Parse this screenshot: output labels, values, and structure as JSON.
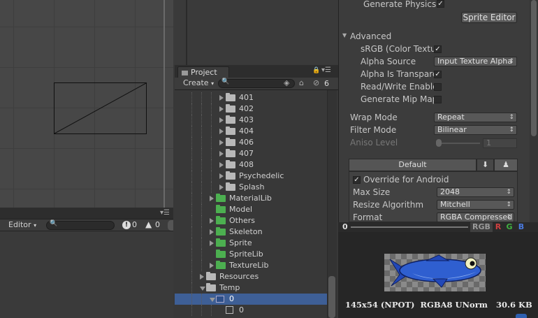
{
  "console": {
    "editor_label": "Editor",
    "error_count": "0",
    "warning_count": "0"
  },
  "project": {
    "tab_label": "Project",
    "create_label": "Create",
    "hidden_count": "6",
    "tree": [
      {
        "label": "401",
        "depth": 4,
        "type": "folder",
        "expanded": false
      },
      {
        "label": "402",
        "depth": 4,
        "type": "folder",
        "expanded": false
      },
      {
        "label": "403",
        "depth": 4,
        "type": "folder",
        "expanded": false
      },
      {
        "label": "404",
        "depth": 4,
        "type": "folder",
        "expanded": false
      },
      {
        "label": "406",
        "depth": 4,
        "type": "folder",
        "expanded": false
      },
      {
        "label": "407",
        "depth": 4,
        "type": "folder",
        "expanded": false
      },
      {
        "label": "408",
        "depth": 4,
        "type": "folder",
        "expanded": false
      },
      {
        "label": "Psychedelic",
        "depth": 4,
        "type": "folder",
        "expanded": false
      },
      {
        "label": "Splash",
        "depth": 4,
        "type": "folder",
        "expanded": false
      },
      {
        "label": "MaterialLib",
        "depth": 3,
        "type": "folder-green",
        "expanded": false
      },
      {
        "label": "Model",
        "depth": 3,
        "type": "folder-green",
        "expanded": null
      },
      {
        "label": "Others",
        "depth": 3,
        "type": "folder-green",
        "expanded": false
      },
      {
        "label": "Skeleton",
        "depth": 3,
        "type": "folder-green",
        "expanded": false
      },
      {
        "label": "Sprite",
        "depth": 3,
        "type": "folder-green",
        "expanded": false
      },
      {
        "label": "SpriteLib",
        "depth": 3,
        "type": "folder-green",
        "expanded": null
      },
      {
        "label": "TextureLib",
        "depth": 3,
        "type": "folder-green",
        "expanded": false
      },
      {
        "label": "Resources",
        "depth": 2,
        "type": "folder",
        "expanded": false
      },
      {
        "label": "Temp",
        "depth": 2,
        "type": "folder",
        "expanded": true
      },
      {
        "label": "0",
        "depth": 3,
        "type": "sprite",
        "expanded": true,
        "selected": true
      },
      {
        "label": "0",
        "depth": 4,
        "type": "subsprite",
        "expanded": null
      }
    ]
  },
  "inspector": {
    "generate_physics": {
      "label": "Generate Physics S",
      "checked": true
    },
    "sprite_editor_button": "Sprite Editor",
    "advanced_label": "Advanced",
    "srgb": {
      "label": "sRGB (Color Textu",
      "checked": true
    },
    "alpha_source": {
      "label": "Alpha Source",
      "value": "Input Texture Alpha"
    },
    "alpha_transparency": {
      "label": "Alpha Is Transpare",
      "checked": true
    },
    "read_write": {
      "label": "Read/Write Enable",
      "checked": false
    },
    "mip_maps": {
      "label": "Generate Mip Map",
      "checked": false
    },
    "wrap_mode": {
      "label": "Wrap Mode",
      "value": "Repeat"
    },
    "filter_mode": {
      "label": "Filter Mode",
      "value": "Bilinear"
    },
    "aniso_level": {
      "label": "Aniso Level",
      "value": "1"
    },
    "platform_default": "Default",
    "override_android": {
      "label": "Override for Android",
      "checked": true
    },
    "max_size": {
      "label": "Max Size",
      "value": "2048"
    },
    "resize_algorithm": {
      "label": "Resize Algorithm",
      "value": "Mitchell"
    },
    "format": {
      "label": "Format",
      "value": "RGBA Compressed"
    }
  },
  "preview": {
    "mip_value": "0",
    "channels": [
      "RGB",
      "R",
      "G",
      "B"
    ],
    "info": "145x54 (NPOT)  RGBA8 UNorm   30.6 KB"
  },
  "colors": {
    "selection": "#3e5f96",
    "green_folder": "#4caf50",
    "fish_blue": "#2f5fd0"
  }
}
